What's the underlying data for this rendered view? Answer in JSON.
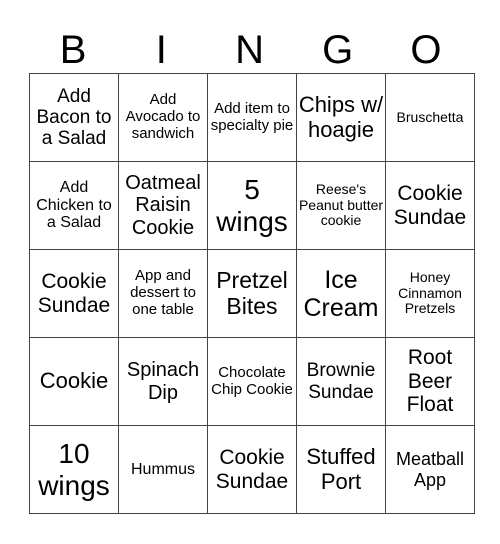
{
  "header": [
    "B",
    "I",
    "N",
    "G",
    "O"
  ],
  "rows": [
    [
      {
        "text": "Add Bacon to a Salad",
        "size": 19
      },
      {
        "text": "Add Avocado to sandwich",
        "size": 15
      },
      {
        "text": "Add item to specialty pie",
        "size": 15
      },
      {
        "text": "Chips w/ hoagie",
        "size": 22
      },
      {
        "text": "Bruschetta",
        "size": 14
      }
    ],
    [
      {
        "text": "Add Chicken to a Salad",
        "size": 16
      },
      {
        "text": "Oatmeal Raisin Cookie",
        "size": 20
      },
      {
        "text": "5 wings",
        "size": 28
      },
      {
        "text": "Reese's Peanut butter cookie",
        "size": 14
      },
      {
        "text": "Cookie Sundae",
        "size": 21
      }
    ],
    [
      {
        "text": "Cookie Sundae",
        "size": 21
      },
      {
        "text": "App and dessert to one table",
        "size": 15
      },
      {
        "text": "Pretzel Bites",
        "size": 23
      },
      {
        "text": "Ice Cream",
        "size": 25
      },
      {
        "text": "Honey Cinnamon Pretzels",
        "size": 14
      }
    ],
    [
      {
        "text": "Cookie",
        "size": 22
      },
      {
        "text": "Spinach Dip",
        "size": 20
      },
      {
        "text": "Chocolate Chip Cookie",
        "size": 15
      },
      {
        "text": "Brownie Sundae",
        "size": 19
      },
      {
        "text": "Root Beer Float",
        "size": 21
      }
    ],
    [
      {
        "text": "10 wings",
        "size": 28
      },
      {
        "text": "Hummus",
        "size": 16
      },
      {
        "text": "Cookie Sundae",
        "size": 21
      },
      {
        "text": "Stuffed Port",
        "size": 22
      },
      {
        "text": "Meatball App",
        "size": 18
      }
    ]
  ]
}
